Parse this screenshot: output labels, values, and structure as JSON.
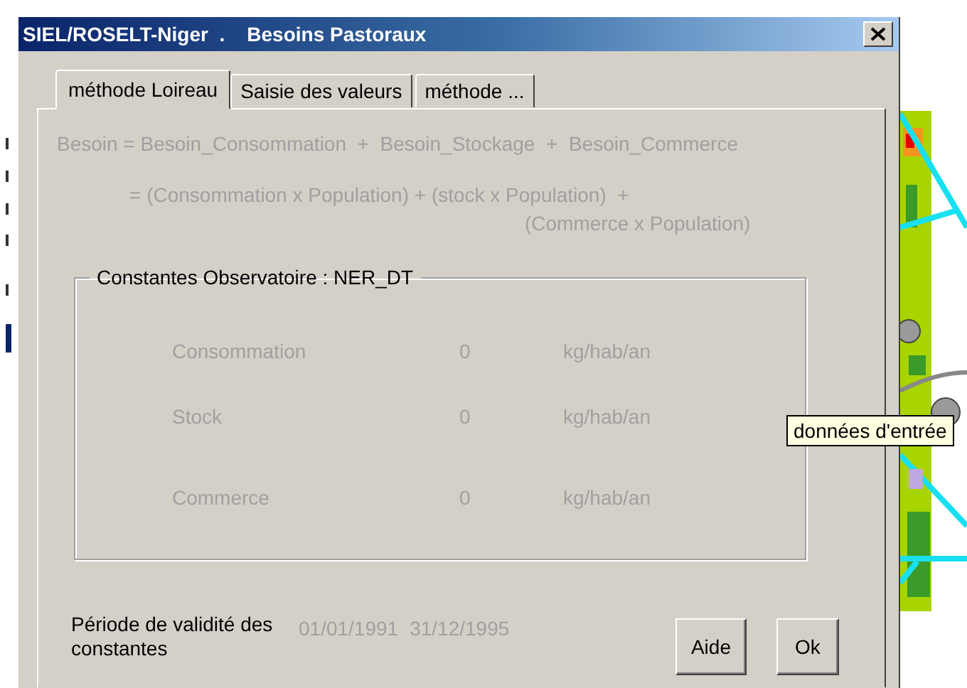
{
  "window": {
    "title": "SIEL/ROSELT-Niger  .    Besoins Pastoraux"
  },
  "tabs": [
    {
      "label": "méthode Loireau",
      "selected": true
    },
    {
      "label": "Saisie des valeurs",
      "selected": false
    },
    {
      "label": "méthode ...",
      "selected": false
    }
  ],
  "formula": {
    "definition": "Besoin = Besoin_Consommation  +  Besoin_Stockage  +  Besoin_Commerce",
    "expansion": [
      "= (Consommation x Population) + (stock x Population)  +",
      "(Commerce x Population)"
    ]
  },
  "constants": {
    "title": "Constantes Observatoire : NER_DT",
    "rows": [
      {
        "name": "Consommation",
        "value": "0",
        "unit": "kg/hab/an"
      },
      {
        "name": "Stock",
        "value": "0",
        "unit": "kg/hab/an"
      },
      {
        "name": "Commerce",
        "value": "0",
        "unit": "kg/hab/an"
      }
    ]
  },
  "validity": {
    "label": "Période de validité des constantes",
    "start": "01/01/1991",
    "end": "31/12/1995"
  },
  "buttons": [
    "Aide",
    "Ok"
  ],
  "tooltip": "données d'entrée"
}
